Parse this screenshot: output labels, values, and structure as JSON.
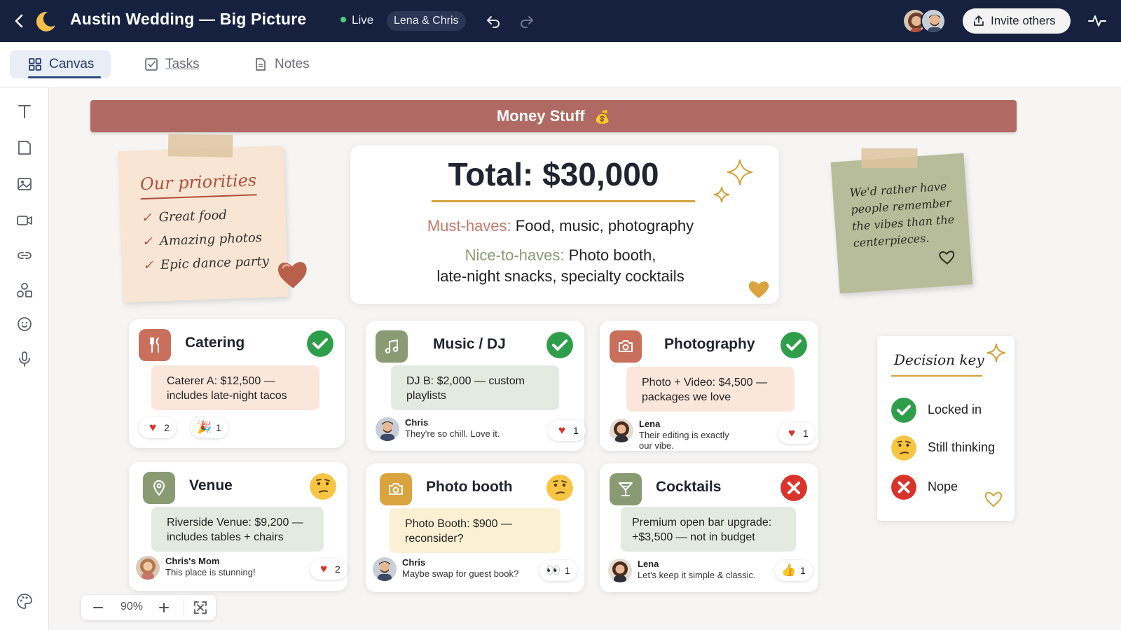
{
  "header": {
    "title": "Austin Wedding — Big Picture",
    "live_label": "Live",
    "collaborators_pill": "Lena & Chris",
    "invite_label": "Invite others"
  },
  "tabs": [
    {
      "label": "Canvas",
      "active": true
    },
    {
      "label": "Tasks",
      "active": false
    },
    {
      "label": "Notes",
      "active": false
    }
  ],
  "banner": {
    "title": "Money Stuff"
  },
  "priorities_note": {
    "title": "Our priorities",
    "items": [
      "Great food",
      "Amazing photos",
      "Epic dance party"
    ]
  },
  "budget": {
    "total": "Total: $30,000",
    "must_label": "Must-haves:",
    "must_value": "Food, music, photography",
    "nice_label": "Nice-to-haves:",
    "nice_value_1": "Photo booth,",
    "nice_value_2": "late-night snacks, specialty cocktails"
  },
  "quote_note": {
    "text": "We'd rather have people remember the vibes than the centerpieces."
  },
  "cards": {
    "catering": {
      "title": "Catering",
      "status": "locked",
      "desc": "Caterer A: $12,500 — includes late-night tacos",
      "reactions": [
        {
          "emoji": "heart",
          "count": "2"
        },
        {
          "emoji": "party-popper",
          "count": "1"
        }
      ]
    },
    "music": {
      "title": "Music / DJ",
      "status": "locked",
      "desc": "DJ B: $2,000 — custom playlists",
      "comment_author": "Chris",
      "comment_text": "They're so chill. Love it.",
      "reaction": {
        "emoji": "heart",
        "count": "1"
      }
    },
    "photography": {
      "title": "Photography",
      "status": "locked",
      "desc": "Photo + Video: $4,500 — packages we love",
      "comment_author": "Lena",
      "comment_text": "Their editing is exactly our vibe.",
      "reaction": {
        "emoji": "heart",
        "count": "1"
      }
    },
    "venue": {
      "title": "Venue",
      "status": "thinking",
      "desc": "Riverside Venue: $9,200 — includes tables + chairs",
      "comment_author": "Chris's Mom",
      "comment_text": "This place is stunning!",
      "reaction": {
        "emoji": "heart",
        "count": "2"
      }
    },
    "photobooth": {
      "title": "Photo booth",
      "status": "thinking",
      "desc": "Photo Booth: $900 — reconsider?",
      "comment_author": "Chris",
      "comment_text": "Maybe swap for guest book?",
      "reaction": {
        "emoji": "eyes",
        "count": "1"
      }
    },
    "cocktails": {
      "title": "Cocktails",
      "status": "nope",
      "desc": "Premium open bar upgrade: +$3,500 — not in budget",
      "comment_author": "Lena",
      "comment_text": "Let's keep it simple & classic.",
      "reaction": {
        "emoji": "thumbs-up",
        "count": "1"
      }
    }
  },
  "decision_key": {
    "title": "Decision key",
    "items": [
      {
        "icon": "green-check-icon",
        "label": "Locked in"
      },
      {
        "icon": "thinking-face-icon",
        "label": "Still thinking"
      },
      {
        "icon": "red-x-icon",
        "label": "Nope"
      }
    ]
  },
  "zoom": {
    "level": "90%"
  },
  "colors": {
    "topbar": "#15213f",
    "banner": "#b06a63",
    "check_green": "#2f9e4a",
    "nope_red": "#d9342b",
    "thinking_yellow": "#f6c543",
    "catering_icon_bg": "#c9705c",
    "music_icon_bg": "#8a9b74",
    "photo_icon_bg": "#c9705c",
    "venue_icon_bg": "#8a9b74",
    "booth_icon_bg": "#d9a33e",
    "cocktail_icon_bg": "#8a9b74"
  }
}
